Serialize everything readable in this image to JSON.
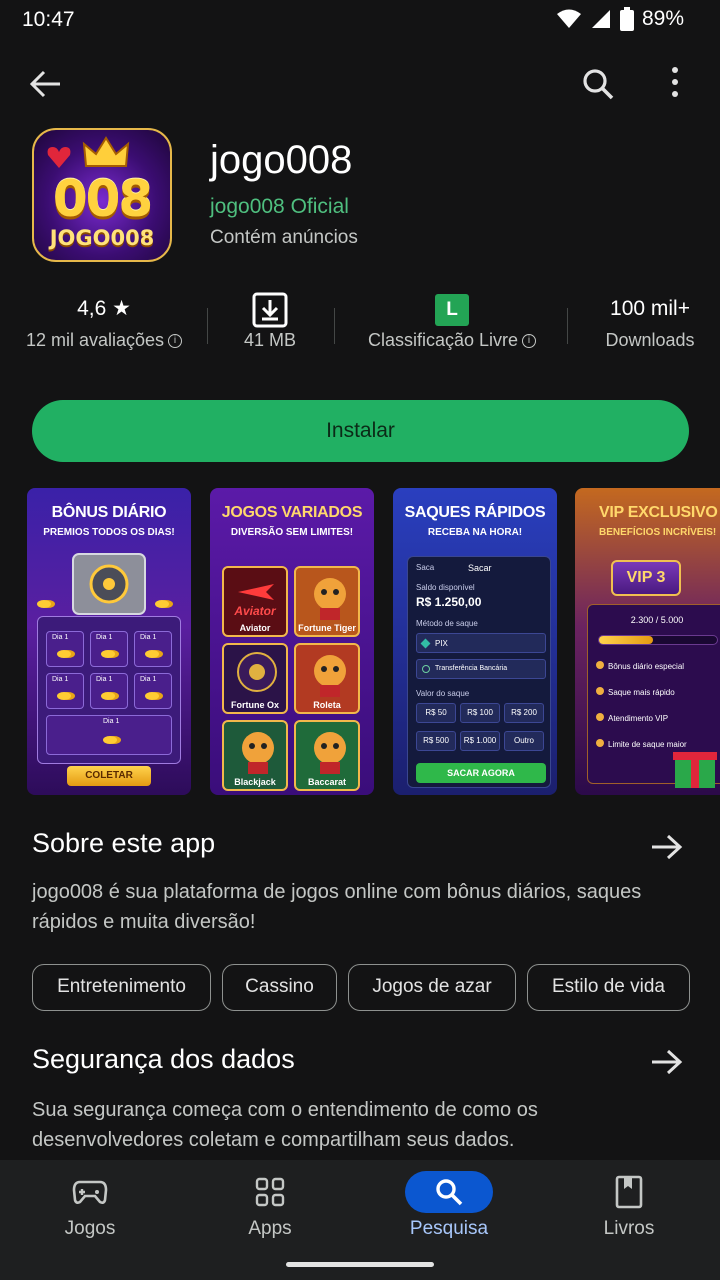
{
  "status": {
    "time": "10:47",
    "battery": "89%"
  },
  "app": {
    "title": "jogo008",
    "developer": "jogo008 Oficial",
    "ads": "Contém anúncios",
    "icon_number": "008",
    "icon_brand": "JOGO008"
  },
  "stats": {
    "rating": "4,6",
    "rating_star": "★",
    "reviews": "12 mil avaliações",
    "size": "41 MB",
    "content_badge": "L",
    "content_rating": "Classificação Livre",
    "downloads": "100 mil+",
    "downloads_label": "Downloads"
  },
  "install_label": "Instalar",
  "screenshots": [
    {
      "title": "BÔNUS DIÁRIO",
      "subtitle": "PREMIOS TODOS OS DIAS!",
      "cell_label": "Dia 1",
      "collect": "COLETAR"
    },
    {
      "title": "JOGOS VARIADOS",
      "subtitle": "DIVERSÃO SEM LIMITES!",
      "games": [
        "Aviator",
        "Fortune Tiger",
        "Fortune Ox",
        "Roleta",
        "Blackjack",
        "Baccarat"
      ],
      "logo_text": "Aviator"
    },
    {
      "title": "SAQUES RÁPIDOS",
      "subtitle": "RECEBA NA HORA!",
      "panel_title": "Sacar",
      "tab_left": "Saca",
      "balance_label": "Saldo disponível",
      "balance": "R$ 1.250,00",
      "method_label": "Método de saque",
      "method_pix": "PIX",
      "method_bank": "Transferência Bancária",
      "amount_label": "Valor do saque",
      "amounts": [
        "R$ 50",
        "R$ 100",
        "R$ 200",
        "R$ 500",
        "R$ 1.000",
        "Outro"
      ],
      "cta": "SACAR AGORA"
    },
    {
      "title": "VIP EXCLUSIVO",
      "subtitle": "BENEFÍCIOS INCRÍVEIS!",
      "vip_badge": "VIP 3",
      "progress": "2.300 / 5.000",
      "progress_fraction": 0.46,
      "benefits": [
        "Bônus diário especial",
        "Saque mais rápido",
        "Atendimento VIP",
        "Limite de saque maior"
      ]
    }
  ],
  "about": {
    "title": "Sobre este app",
    "text": "jogo008 é sua plataforma de jogos online com bônus diários, saques rápidos e muita diversão!"
  },
  "tags": [
    "Entretenimento",
    "Cassino",
    "Jogos de azar",
    "Estilo de vida"
  ],
  "safety": {
    "title": "Segurança dos dados",
    "text": "Sua segurança começa com o entendimento de como os desenvolvedores coletam e compartilham seus dados."
  },
  "nav": [
    {
      "label": "Jogos",
      "icon": "gamepad-icon"
    },
    {
      "label": "Apps",
      "icon": "apps-grid-icon"
    },
    {
      "label": "Pesquisa",
      "icon": "search-icon",
      "active": true
    },
    {
      "label": "Livros",
      "icon": "book-icon"
    }
  ],
  "colors": {
    "accent_green": "#21b063",
    "developer_green": "#4fbf7f",
    "nav_active": "#0b57d0"
  }
}
